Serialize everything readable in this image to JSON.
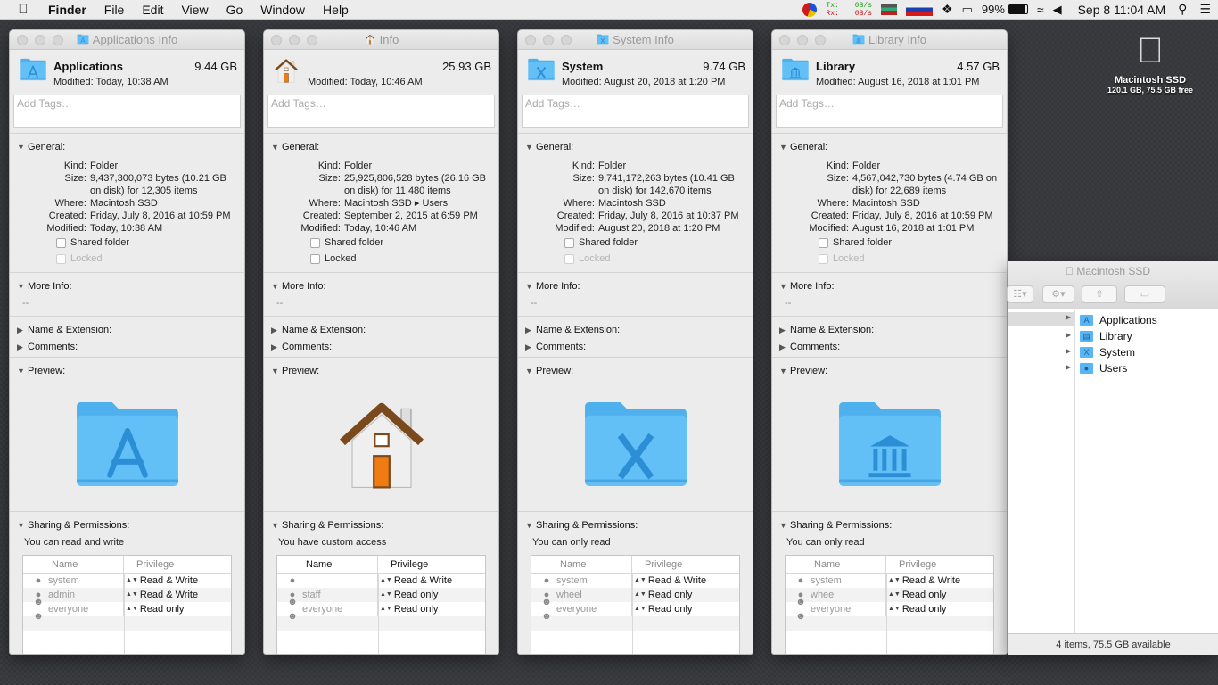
{
  "menubar": {
    "app": "Finder",
    "menus": [
      "File",
      "Edit",
      "View",
      "Go",
      "Window",
      "Help"
    ],
    "tx_label": "Tx:",
    "rx_label": "Rx:",
    "tx_rate": "0B/s",
    "rx_rate": "0B/s",
    "battery": "99%",
    "clock": "Sep 8  11:04 AM"
  },
  "desktop_drive": {
    "name": "Macintosh SSD",
    "stats": "120.1 GB, 75.5 GB free"
  },
  "labels": {
    "add_tags": "Add Tags…",
    "general": "General:",
    "kind": "Kind:",
    "size": "Size:",
    "where": "Where:",
    "created": "Created:",
    "modified": "Modified:",
    "shared_folder": "Shared folder",
    "locked": "Locked",
    "more_info": "More Info:",
    "more_info_value": "--",
    "name_ext": "Name & Extension:",
    "comments": "Comments:",
    "preview": "Preview:",
    "sharing": "Sharing & Permissions:",
    "col_name": "Name",
    "col_privilege": "Privilege"
  },
  "windows": [
    {
      "title": "Applications Info",
      "name": "Applications",
      "size": "9.44 GB",
      "modified_line": "Modified: Today, 10:38 AM",
      "kind": "Folder",
      "size_detail": "9,437,300,073 bytes (10.21 GB on disk) for 12,305 items",
      "where": "Macintosh SSD",
      "created": "Friday, July 8, 2016 at 10:59 PM",
      "modified": "Today, 10:38 AM",
      "access": "You can read and write",
      "icon": "applications-folder-icon",
      "perms": [
        {
          "user": "system",
          "priv": "Read & Write"
        },
        {
          "user": "admin",
          "priv": "Read & Write"
        },
        {
          "user": "everyone",
          "priv": "Read only"
        }
      ]
    },
    {
      "title": "Info",
      "name": "",
      "size": "25.93 GB",
      "modified_line": "Modified: Today, 10:46 AM",
      "kind": "Folder",
      "size_detail": "25,925,806,528 bytes (26.16 GB on disk) for 11,480 items",
      "where": "Macintosh SSD ▸ Users",
      "created": "September 2, 2015 at 6:59 PM",
      "modified": "Today, 10:46 AM",
      "access": "You have custom access",
      "icon": "home-folder-icon",
      "perms": [
        {
          "user": "",
          "priv": "Read & Write"
        },
        {
          "user": "staff",
          "priv": "Read only"
        },
        {
          "user": "everyone",
          "priv": "Read only"
        }
      ]
    },
    {
      "title": "System Info",
      "name": "System",
      "size": "9.74 GB",
      "modified_line": "Modified: August 20, 2018 at 1:20 PM",
      "kind": "Folder",
      "size_detail": "9,741,172,263 bytes (10.41 GB on disk) for 142,670 items",
      "where": "Macintosh SSD",
      "created": "Friday, July 8, 2016 at 10:37 PM",
      "modified": "August 20, 2018 at 1:20 PM",
      "access": "You can only read",
      "icon": "system-folder-icon",
      "perms": [
        {
          "user": "system",
          "priv": "Read & Write"
        },
        {
          "user": "wheel",
          "priv": "Read only"
        },
        {
          "user": "everyone",
          "priv": "Read only"
        }
      ]
    },
    {
      "title": "Library Info",
      "name": "Library",
      "size": "4.57 GB",
      "modified_line": "Modified: August 16, 2018 at 1:01 PM",
      "kind": "Folder",
      "size_detail": "4,567,042,730 bytes (4.74 GB on disk) for 22,689 items",
      "where": "Macintosh SSD",
      "created": "Friday, July 8, 2016 at 10:59 PM",
      "modified": "August 16, 2018 at 1:01 PM",
      "access": "You can only read",
      "icon": "library-folder-icon",
      "perms": [
        {
          "user": "system",
          "priv": "Read & Write"
        },
        {
          "user": "wheel",
          "priv": "Read only"
        },
        {
          "user": "everyone",
          "priv": "Read only"
        }
      ]
    }
  ],
  "finder": {
    "title": "Macintosh SSD",
    "items": [
      "Applications",
      "Library",
      "System",
      "Users"
    ],
    "status": "4 items, 75.5 GB available"
  }
}
